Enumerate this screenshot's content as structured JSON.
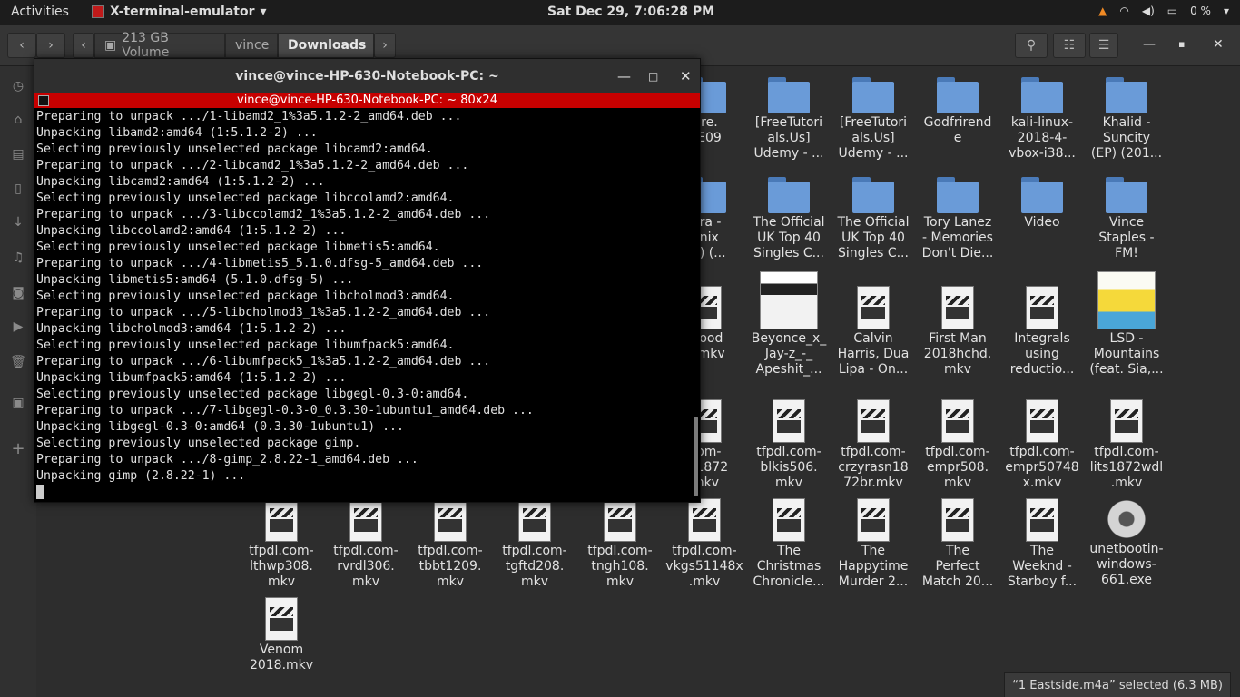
{
  "topbar": {
    "activities": "Activities",
    "app_name": "X-terminal-emulator",
    "clock": "Sat Dec 29,  7:06:28 PM",
    "battery": "0 %"
  },
  "header": {
    "breadcrumbs": [
      "213 GB Volume",
      "vince",
      "Downloads"
    ]
  },
  "terminal": {
    "title": "vince@vince-HP-630-Notebook-PC: ~",
    "subtitle": "vince@vince-HP-630-Notebook-PC: ~ 80x24",
    "lines": [
      "Preparing to unpack .../1-libamd2_1%3a5.1.2-2_amd64.deb ...",
      "Unpacking libamd2:amd64 (1:5.1.2-2) ...",
      "Selecting previously unselected package libcamd2:amd64.",
      "Preparing to unpack .../2-libcamd2_1%3a5.1.2-2_amd64.deb ...",
      "Unpacking libcamd2:amd64 (1:5.1.2-2) ...",
      "Selecting previously unselected package libccolamd2:amd64.",
      "Preparing to unpack .../3-libccolamd2_1%3a5.1.2-2_amd64.deb ...",
      "Unpacking libccolamd2:amd64 (1:5.1.2-2) ...",
      "Selecting previously unselected package libmetis5:amd64.",
      "Preparing to unpack .../4-libmetis5_5.1.0.dfsg-5_amd64.deb ...",
      "Unpacking libmetis5:amd64 (5.1.0.dfsg-5) ...",
      "Selecting previously unselected package libcholmod3:amd64.",
      "Preparing to unpack .../5-libcholmod3_1%3a5.1.2-2_amd64.deb ...",
      "Unpacking libcholmod3:amd64 (1:5.1.2-2) ...",
      "Selecting previously unselected package libumfpack5:amd64.",
      "Preparing to unpack .../6-libumfpack5_1%3a5.1.2-2_amd64.deb ...",
      "Unpacking libumfpack5:amd64 (1:5.1.2-2) ...",
      "Selecting previously unselected package libgegl-0.3-0:amd64.",
      "Preparing to unpack .../7-libgegl-0.3-0_0.3.30-1ubuntu1_amd64.deb ...",
      "Unpacking libgegl-0.3-0:amd64 (0.3.30-1ubuntu1) ...",
      "Selecting previously unselected package gimp.",
      "Preparing to unpack .../8-gimp_2.8.22-1_amd64.deb ...",
      "Unpacking gimp (2.8.22-1) ..."
    ]
  },
  "files": {
    "row1": [
      "hre.\n5E09",
      "[FreeTutori\nals.Us]\nUdemy - ...",
      "[FreeTutori\nals.Us]\nUdemy - ...",
      "Godfrirend\ne",
      "kali-linux-\n2018-4-\nvbox-i38...",
      "Khalid -\nSuncity\n(EP) (201..."
    ],
    "row2": [
      "Ora -\nenix\nxe) (...",
      "The Official\nUK Top 40\nSingles C...",
      "The Official\nUK Top 40\nSingles C...",
      "Tory Lanez\n- Memories\nDon't Die...",
      "Video",
      "Vince\nStaples -\nFM!"
    ],
    "row3": [
      "blood\n3.mkv",
      "Beyonce_x_\nJay-z_-_\nApeshit_...",
      "Calvin\nHarris, Dua\nLipa - On...",
      "First Man\n2018hchd.\nmkv",
      "Integrals\nusing\nreductio...",
      "LSD -\nMountains\n(feat. Sia,..."
    ],
    "row4": [
      "com-\nhr1872\nmkv",
      "tfpdl.com-\nblkis506.\nmkv",
      "tfpdl.com-\ncrzyrasn18\n72br.mkv",
      "tfpdl.com-\nempr508.\nmkv",
      "tfpdl.com-\nempr50748\nx.mkv",
      "tfpdl.com-\nlits1872wdl\n.mkv"
    ],
    "row5": [
      "tfpdl.com-\nlthwp308.\nmkv",
      "tfpdl.com-\nrvrdl306.\nmkv",
      "tfpdl.com-\ntbbt1209.\nmkv",
      "tfpdl.com-\ntgftd208.\nmkv",
      "tfpdl.com-\ntngh108.\nmkv",
      "tfpdl.com-\nvkgs51148x\n.mkv",
      "The\nChristmas\nChronicle...",
      "The\nHappytime\nMurder 2...",
      "The\nPerfect\nMatch 20...",
      "The\nWeeknd -\nStarboy f...",
      "unetbootin-\nwindows-\n661.exe"
    ],
    "row6": [
      "Venom\n2018.mkv"
    ]
  },
  "status": {
    "text": "“1 Eastside.m4a” selected  (6.3 MB)"
  }
}
